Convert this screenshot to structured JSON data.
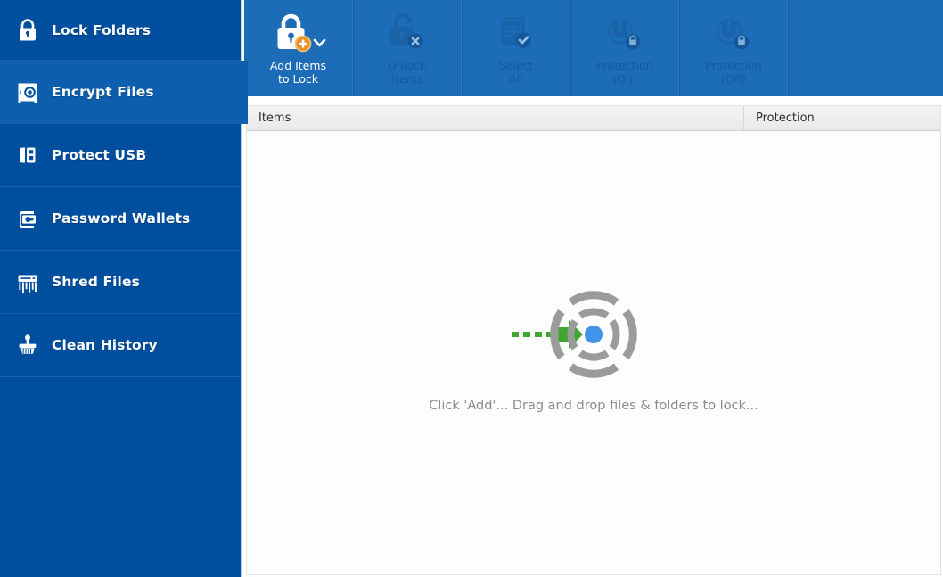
{
  "sidebar": {
    "items": [
      {
        "icon": "padlock-icon",
        "label": "Lock Folders",
        "state": "selected"
      },
      {
        "icon": "safe-vault-icon",
        "label": "Encrypt Files",
        "state": "hover"
      },
      {
        "icon": "usb-drive-icon",
        "label": "Protect USB",
        "state": "normal"
      },
      {
        "icon": "wallet-icon",
        "label": "Password Wallets",
        "state": "normal"
      },
      {
        "icon": "shredder-icon",
        "label": "Shred Files",
        "state": "normal"
      },
      {
        "icon": "brush-icon",
        "label": "Clean History",
        "state": "normal"
      }
    ]
  },
  "toolbar": {
    "buttons": [
      {
        "icon": "lock-plus-icon",
        "line1": "Add Items",
        "line2": "to Lock",
        "enabled": true,
        "has_dropdown": true
      },
      {
        "icon": "unlock-x-icon",
        "line1": "Unlock",
        "line2": "Items",
        "enabled": false,
        "has_dropdown": false
      },
      {
        "icon": "document-check-icon",
        "line1": "Select",
        "line2": "All",
        "enabled": false,
        "has_dropdown": false
      },
      {
        "icon": "power-lock-icon",
        "line1": "Protection",
        "line2": "(On)",
        "enabled": false,
        "has_dropdown": false
      },
      {
        "icon": "power-lock-icon",
        "line1": "Protection",
        "line2": "(Off)",
        "enabled": false,
        "has_dropdown": false
      }
    ]
  },
  "list": {
    "columns": [
      {
        "label": "Items"
      },
      {
        "label": "Protection"
      }
    ],
    "rows": [],
    "empty_hint": "Click 'Add'... Drag and drop files & folders to lock...",
    "empty_graphic": "drag-drop-target-icon"
  },
  "colors": {
    "sidebar_bg": "#004f9e",
    "sidebar_hover": "#0d5fae",
    "toolbar_bg": "#1c6cb8",
    "toolbar_disabled_text": "#1757a0",
    "accent_orange": "#e8a13a",
    "arrow_green": "#3fa72f",
    "target_gray": "#9b9b9b",
    "center_dot_blue": "#3f93e8",
    "hint_text": "#8b8b8b"
  }
}
